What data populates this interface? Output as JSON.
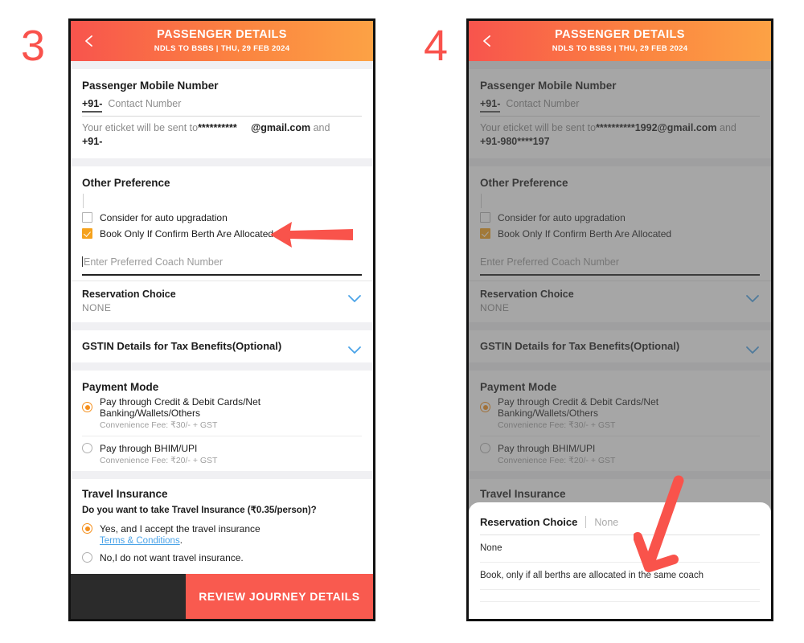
{
  "steps": {
    "three": "3",
    "four": "4"
  },
  "header": {
    "title": "PASSENGER DETAILS",
    "subtitle": "NDLS TO BSBS |  THU, 29 FEB  2024",
    "back_icon": "back-chevron-icon"
  },
  "mobile": {
    "section_title": "Passenger Mobile Number",
    "country_code": "+91-",
    "placeholder": "Contact Number",
    "eticket_prefix": "Your eticket will be sent to",
    "eticket_masked_a": "**********",
    "eticket_masked_b": "**********1992@gmail.com",
    "eticket_domain": "@gmail.com",
    "eticket_and": " and",
    "eticket_phone_a": "+91-",
    "eticket_phone_b": "+91-980****197"
  },
  "preference": {
    "section_title": "Other Preference",
    "auto_upgrade_label": "Consider for auto upgradation",
    "auto_upgrade_checked": false,
    "confirm_berth_label": "Book Only If Confirm Berth Are Allocated",
    "confirm_berth_checked": true,
    "coach_placeholder": "Enter Preferred Coach Number",
    "coach_value": ""
  },
  "reservation": {
    "label": "Reservation Choice",
    "value": "NONE",
    "chevron_icon": "chevron-down-icon"
  },
  "gstin": {
    "label": "GSTIN Details for Tax Benefits(Optional)",
    "chevron_icon": "chevron-down-icon"
  },
  "payment": {
    "section_title": "Payment Mode",
    "options": [
      {
        "label": "Pay through Credit & Debit Cards/Net Banking/Wallets/Others",
        "fee": "Convenience Fee: ₹30/- + GST",
        "selected": true
      },
      {
        "label": "Pay through BHIM/UPI",
        "fee": "Convenience Fee: ₹20/- + GST",
        "selected": false
      }
    ]
  },
  "insurance": {
    "section_title": "Travel Insurance",
    "question": "Do you want to take Travel Insurance (₹0.35/person)?",
    "yes_label": "Yes, and I accept the travel insurance",
    "yes_selected": true,
    "terms_link": "Terms & Conditions",
    "terms_period": ".",
    "no_label": "No,I do not want travel insurance.",
    "no_selected": false
  },
  "footer": {
    "cta_label": "REVIEW JOURNEY DETAILS",
    "cta_color": "#f95a4f"
  },
  "sheet": {
    "title": "Reservation Choice",
    "hint": "None",
    "options": [
      "None",
      "Book, only if all berths are allocated in the same coach",
      ""
    ]
  },
  "annotations": {
    "arrow_left_icon": "left-arrow-annotation",
    "arrow_down_icon": "down-arrow-annotation",
    "arrow_color": "#f9534b"
  }
}
